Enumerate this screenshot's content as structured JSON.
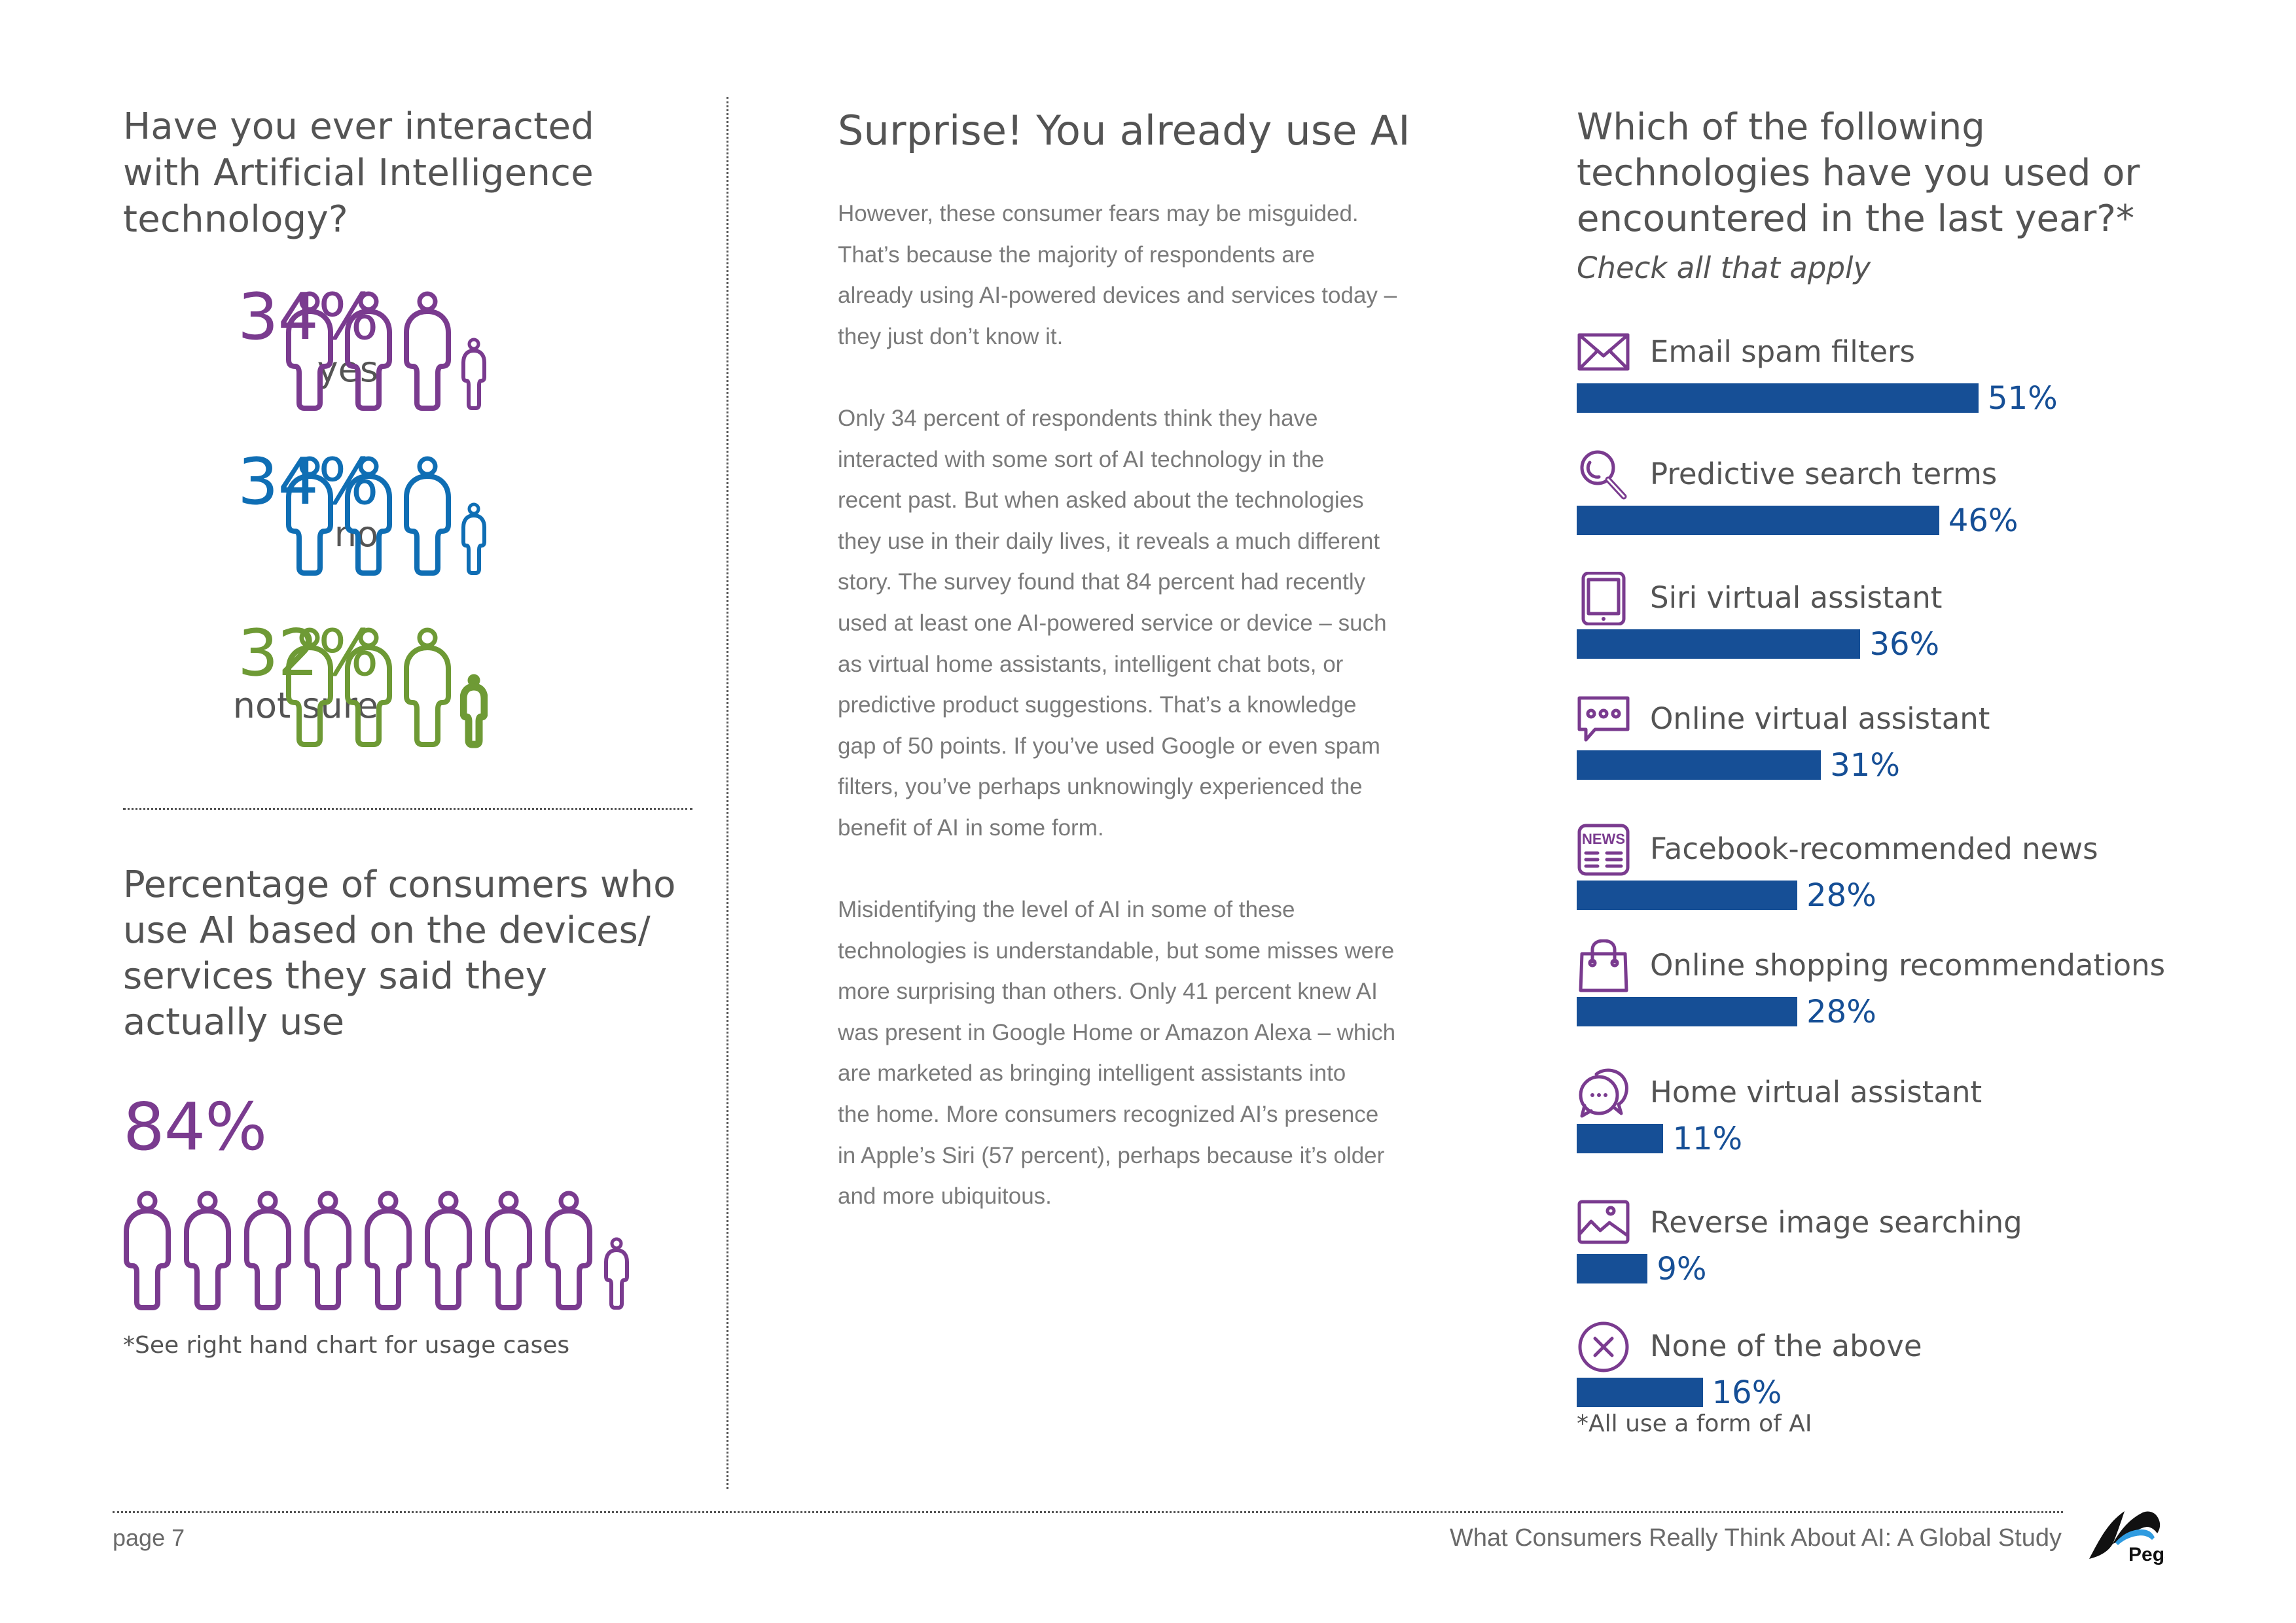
{
  "left": {
    "question": "Have you ever interacted with Artificial Intelligence technology?",
    "question_lines": [
      "Have you ever interacted",
      "with Artificial Intelligence",
      "technology?"
    ],
    "stats": [
      {
        "percent": "34%",
        "label": "yes",
        "value": 34,
        "color": "#7a3b8f",
        "adults": 3,
        "child_style": "outline"
      },
      {
        "percent": "34%",
        "label": "no",
        "value": 34,
        "color": "#0f6eb4",
        "adults": 3,
        "child_style": "outline"
      },
      {
        "percent": "32%",
        "label": "not sure",
        "value": 32,
        "color": "#6e9a35",
        "adults": 3,
        "child_style": "filled"
      }
    ],
    "usage_title_lines": [
      "Percentage of consumers who",
      "use AI based on the devices/",
      "services they said they",
      "actually use"
    ],
    "usage_percent": "84%",
    "usage_value": 84,
    "usage_color": "#7a3b8f",
    "usage_adults": 8,
    "footnote": "*See right hand chart for usage cases"
  },
  "middle": {
    "title": "Surprise! You already use AI",
    "paragraphs": [
      [
        "However, these consumer fears may be misguided.",
        "That’s because the majority of respondents are",
        "already using AI-powered devices and services today –",
        "they just don’t know it."
      ],
      [
        "Only 34 percent of respondents think they have",
        "interacted with some sort of AI technology in the",
        "recent past. But when asked about the technologies",
        "they use in their daily lives, it reveals a much different",
        "story. The survey found that 84 percent had recently",
        "used at least one AI-powered service or device – such",
        "as virtual home assistants, intelligent chat bots, or",
        "predictive product suggestions. That’s a knowledge",
        "gap of 50 points. If you’ve used Google or even spam",
        "filters, you’ve perhaps unknowingly experienced the",
        "benefit of AI in some form."
      ],
      [
        "Misidentifying the level of AI in some of these",
        "technologies is understandable, but some misses were",
        "more surprising than others. Only 41 percent knew AI",
        "was present in Google Home or Amazon Alexa – which",
        "are marketed as bringing intelligent assistants into",
        "the home. More consumers recognized AI’s presence",
        "in Apple’s Siri (57 percent), perhaps because it’s older",
        "and more ubiquitous."
      ]
    ]
  },
  "right": {
    "title_lines": [
      "Which of the following",
      "technologies have you used or",
      "encountered in the last year?*"
    ],
    "subtitle": "Check all that apply",
    "footnote": "*All use a form of AI"
  },
  "chart_data": {
    "type": "bar",
    "orientation": "horizontal",
    "title": "Which of the following technologies have you used or encountered in the last year?*",
    "subtitle": "Check all that apply",
    "categories": [
      "Email spam filters",
      "Predictive search terms",
      "Siri virtual assistant",
      "Online virtual assistant",
      "Facebook-recommended news",
      "Online shopping recommendations",
      "Home virtual assistant",
      "Reverse image searching",
      "None of the above"
    ],
    "values": [
      51,
      46,
      36,
      31,
      28,
      28,
      11,
      9,
      16
    ],
    "value_labels": [
      "51%",
      "46%",
      "36%",
      "31%",
      "28%",
      "28%",
      "11%",
      "9%",
      "16%"
    ],
    "icons": [
      "envelope-icon",
      "magnifier-icon",
      "tablet-icon",
      "chat-bubble-icon",
      "news-icon",
      "shopping-bag-icon",
      "speech-bubbles-icon",
      "image-icon",
      "x-circle-icon"
    ],
    "unit": "%",
    "xlim": [
      0,
      100
    ],
    "bar_color": "#164f96",
    "icon_color": "#7a3b8f",
    "grid": false,
    "footnote": "*All use a form of AI"
  },
  "footer": {
    "page": "page 7",
    "doc_title": "What Consumers Really Think About AI: A Global Study",
    "logo_text": "Pega"
  }
}
